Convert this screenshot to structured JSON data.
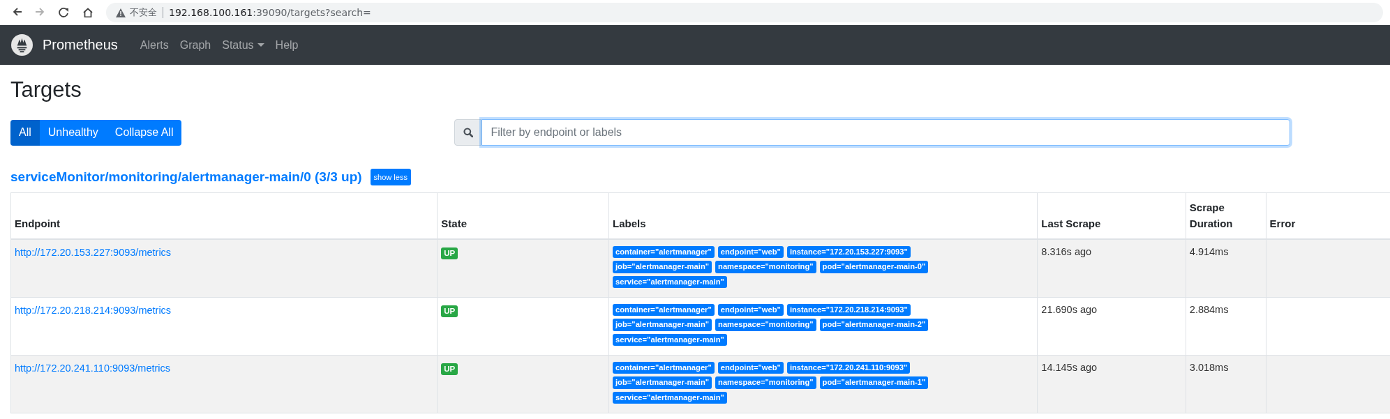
{
  "browser": {
    "nav_buttons": [
      {
        "kind": "back",
        "disabled": false
      },
      {
        "kind": "forward",
        "disabled": true
      },
      {
        "kind": "reload",
        "disabled": false
      },
      {
        "kind": "home",
        "disabled": false
      }
    ],
    "security": "不安全",
    "url_host": "192.168.100.161",
    "url_rest": ":39090/targets?search="
  },
  "navbar": {
    "brand": "Prometheus",
    "links": [
      {
        "label": "Alerts",
        "kind": "link"
      },
      {
        "label": "Graph",
        "kind": "link"
      },
      {
        "label": "Status",
        "kind": "dropdown"
      },
      {
        "label": "Help",
        "kind": "link"
      }
    ]
  },
  "page_title": "Targets",
  "filter_buttons": [
    {
      "label": "All",
      "selected": true
    },
    {
      "label": "Unhealthy",
      "selected": false
    },
    {
      "label": "Collapse All",
      "selected": false
    }
  ],
  "search": {
    "placeholder": "Filter by endpoint or labels"
  },
  "pool": {
    "title": "serviceMonitor/monitoring/alertmanager-main/0 (3/3 up)",
    "toggle": "show less",
    "columns": [
      "Endpoint",
      "State",
      "Labels",
      "Last Scrape",
      "Scrape Duration",
      "Error"
    ],
    "rows": [
      {
        "endpoint": "http://172.20.153.227:9093/metrics",
        "state": "UP",
        "labels": [
          "container=\"alertmanager\"",
          "endpoint=\"web\"",
          "instance=\"172.20.153.227:9093\"",
          "job=\"alertmanager-main\"",
          "namespace=\"monitoring\"",
          "pod=\"alertmanager-main-0\"",
          "service=\"alertmanager-main\""
        ],
        "last_scrape": "8.316s ago",
        "duration": "4.914ms"
      },
      {
        "endpoint": "http://172.20.218.214:9093/metrics",
        "state": "UP",
        "labels": [
          "container=\"alertmanager\"",
          "endpoint=\"web\"",
          "instance=\"172.20.218.214:9093\"",
          "job=\"alertmanager-main\"",
          "namespace=\"monitoring\"",
          "pod=\"alertmanager-main-2\"",
          "service=\"alertmanager-main\""
        ],
        "last_scrape": "21.690s ago",
        "duration": "2.884ms"
      },
      {
        "endpoint": "http://172.20.241.110:9093/metrics",
        "state": "UP",
        "labels": [
          "container=\"alertmanager\"",
          "endpoint=\"web\"",
          "instance=\"172.20.241.110:9093\"",
          "job=\"alertmanager-main\"",
          "namespace=\"monitoring\"",
          "pod=\"alertmanager-main-1\"",
          "service=\"alertmanager-main\""
        ],
        "last_scrape": "14.145s ago",
        "duration": "3.018ms"
      }
    ]
  }
}
